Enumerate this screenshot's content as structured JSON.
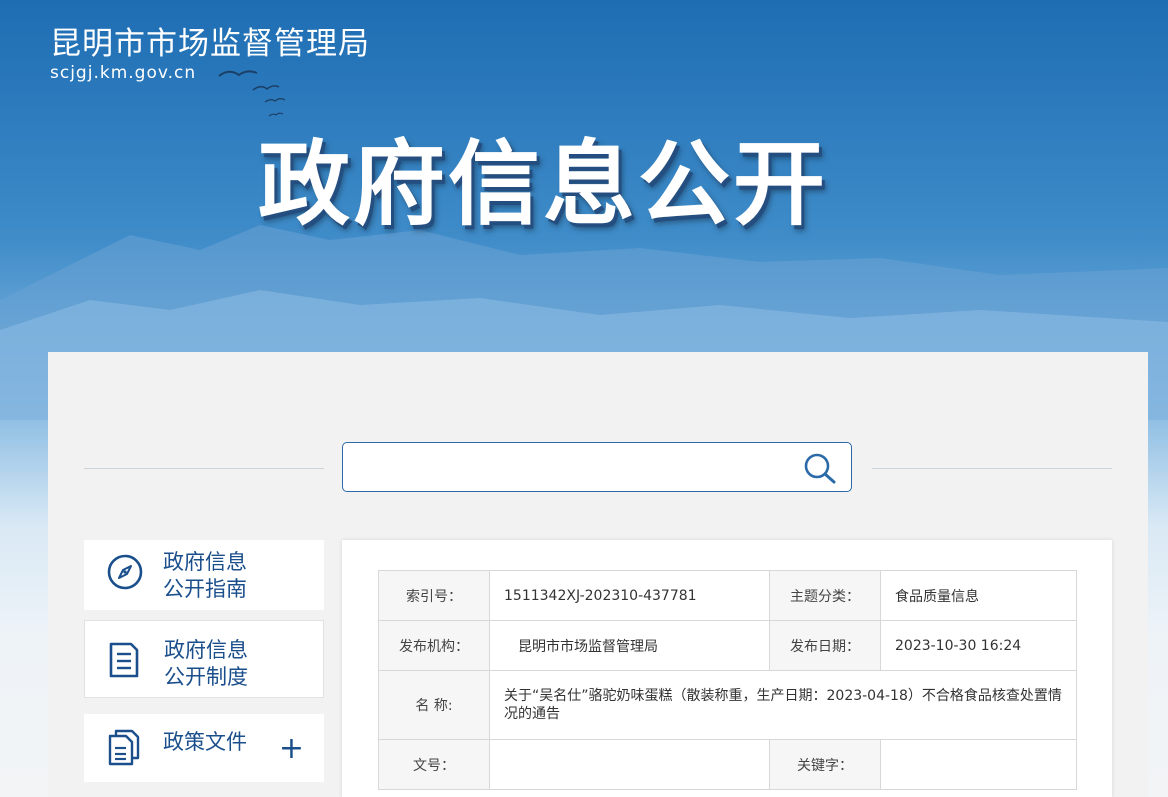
{
  "header": {
    "site_title": "昆明市市场监督管理局",
    "site_domain": "scjgj.km.gov.cn",
    "hero_title": "政府信息公开"
  },
  "search": {
    "value": "",
    "placeholder": ""
  },
  "sidebar": {
    "items": [
      {
        "label": "政府信息\n公开指南",
        "icon": "compass-icon"
      },
      {
        "label": "政府信息\n公开制度",
        "icon": "document-icon"
      },
      {
        "label": "政策文件",
        "icon": "files-icon",
        "expand": "+"
      }
    ]
  },
  "meta": {
    "index_label": "索引号：",
    "index_value": "1511342XJ-202310-437781",
    "topic_label": "主题分类：",
    "topic_value": "食品质量信息",
    "publisher_label": "发布机构：",
    "publisher_value": "昆明市市场监督管理局",
    "date_label": "发布日期：",
    "date_value": "2023-10-30 16:24",
    "name_label": "名 称:",
    "name_value": "关于“吴名仕”骆驼奶味蛋糕（散装称重，生产日期：2023-04-18）不合格食品核查处置情况的通告",
    "docno_label": "文号：",
    "docno_value": "",
    "keywords_label": "关键字：",
    "keywords_value": ""
  },
  "colors": {
    "brand_blue": "#1b4f8c",
    "search_border": "#2b6aa8"
  }
}
